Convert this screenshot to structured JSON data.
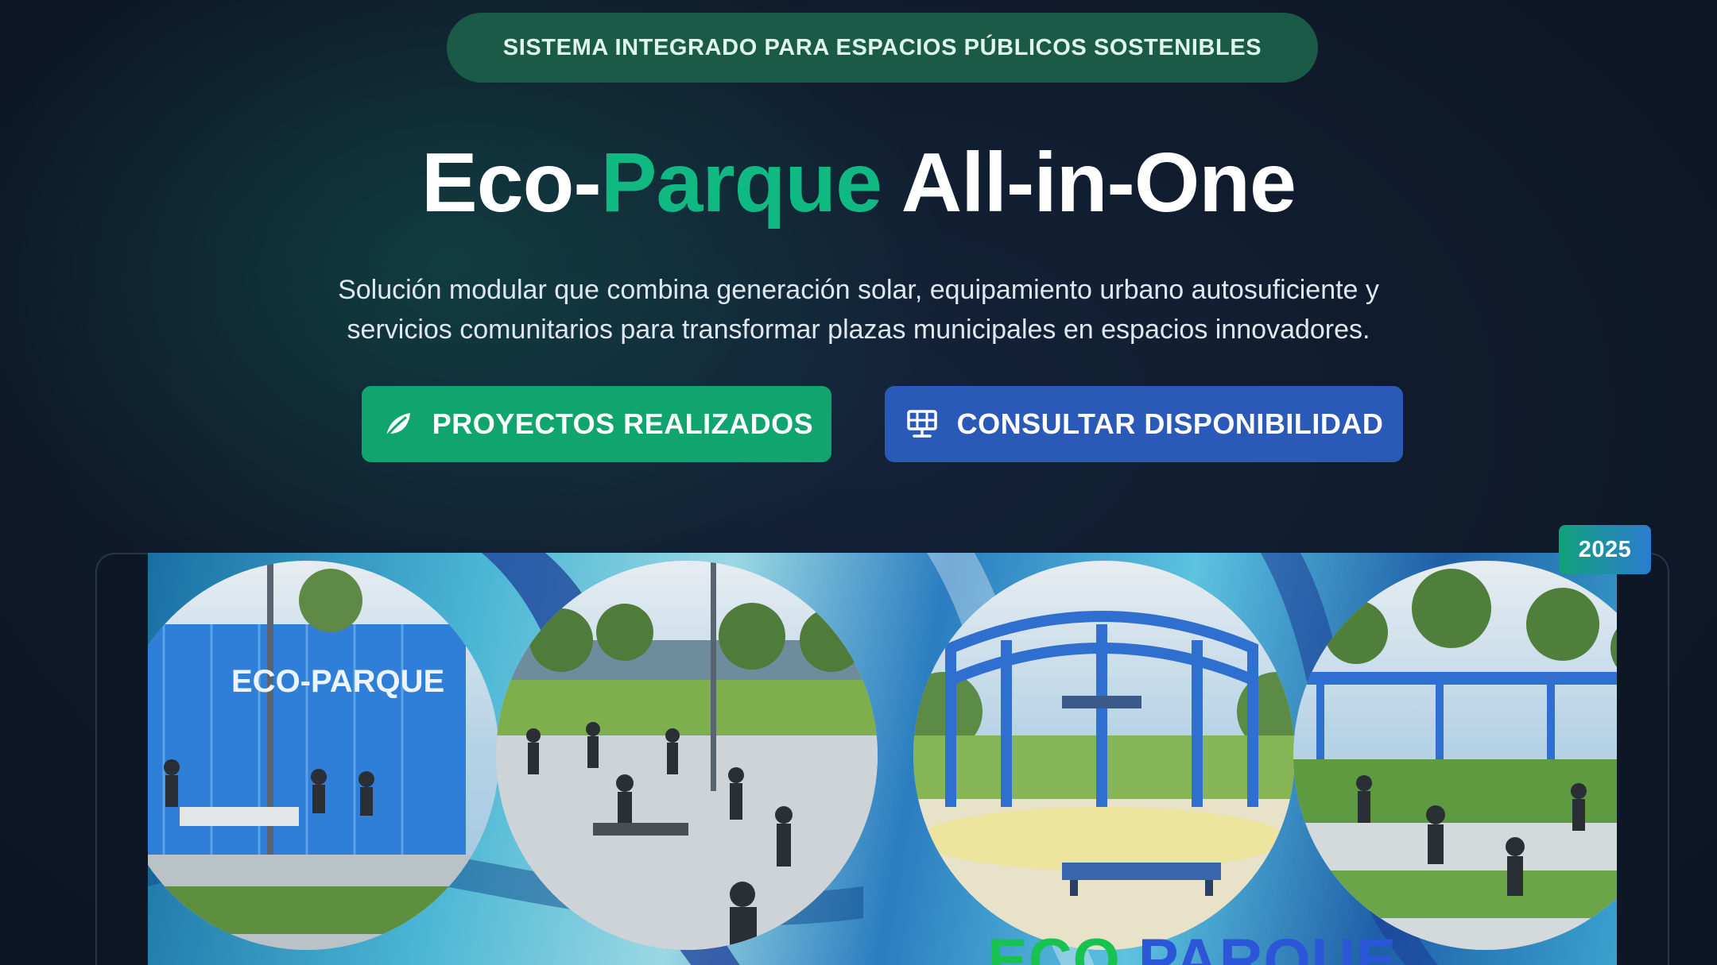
{
  "hero": {
    "eyebrow": "SISTEMA INTEGRADO PARA ESPACIOS PÚBLICOS SOSTENIBLES",
    "title_prefix": "Eco-",
    "title_accent": "Parque",
    "title_suffix": " All-in-One",
    "subtitle_line1": "Solución modular que combina generación solar, equipamiento urbano autosuficiente y",
    "subtitle_line2": "servicios comunitarios para transformar plazas municipales en espacios innovadores."
  },
  "actions": {
    "primary_label": "PROYECTOS REALIZADOS",
    "primary_icon": "leaf-icon",
    "secondary_label": "CONSULTAR DISPONIBILIDAD",
    "secondary_icon": "solar-panel-icon"
  },
  "banner": {
    "year_badge": "2025",
    "photo1_sign": "ECO-PARQUE",
    "brand_eco": "ECO",
    "brand_parque": "PARQUE"
  },
  "colors": {
    "accent_green": "#10b981",
    "button_green": "#10a46e",
    "button_blue": "#2a59b8",
    "background": "#0f1a2a"
  }
}
